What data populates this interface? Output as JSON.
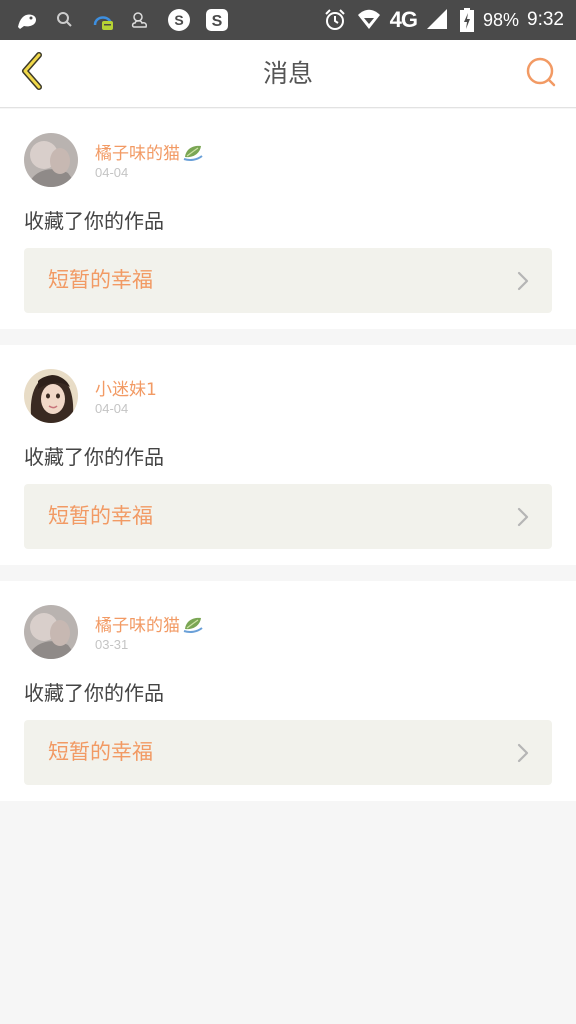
{
  "status_bar": {
    "network": "4G",
    "battery": "98%",
    "time": "9:32",
    "icons": [
      "bird-icon",
      "search-icon",
      "notification-app-icon",
      "weather-icon",
      "sogou-icon",
      "sohu-icon",
      "alarm-icon",
      "wifi-icon",
      "signal-icon",
      "battery-icon"
    ]
  },
  "header": {
    "title": "消息",
    "back_icon": "chevron-left-icon",
    "search_icon": "search-icon",
    "accent_color": "#f29a64"
  },
  "messages": [
    {
      "username": "橘子味的猫",
      "date": "04-04",
      "action": "收藏了你的作品",
      "work_title": "短暂的幸福"
    },
    {
      "username": "小迷妹1",
      "date": "04-04",
      "action": "收藏了你的作品",
      "work_title": "短暂的幸福"
    },
    {
      "username": "橘子味的猫",
      "date": "03-31",
      "action": "收藏了你的作品",
      "work_title": "短暂的幸福"
    }
  ]
}
